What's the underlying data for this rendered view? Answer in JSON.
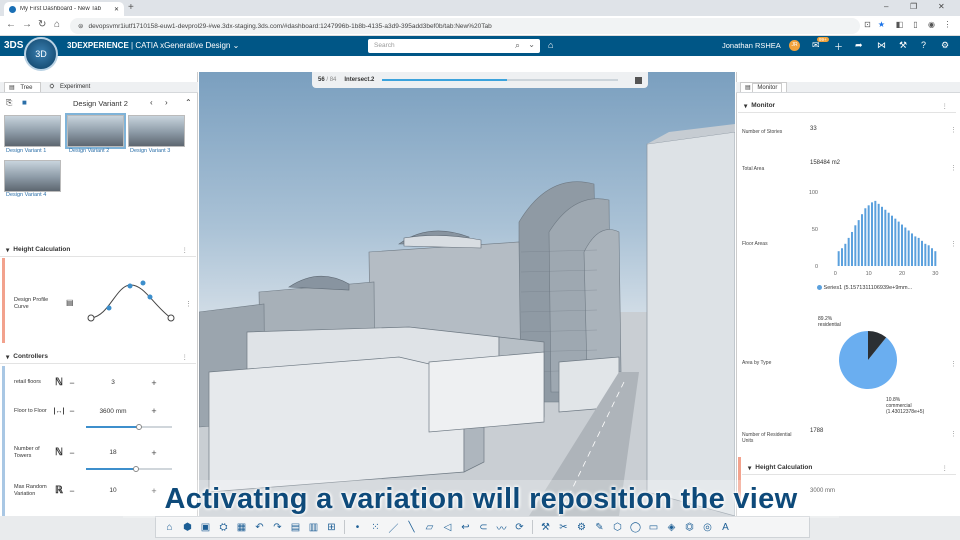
{
  "browser": {
    "tab_title": "My First Dashboard - New Tab",
    "new_tab": "+",
    "url": "devopsvmr1iutf1710158-euw1-devprol29-#we.3dx-staging.3ds.com/#dashboard:1247996b-1b8b-4135-a3d9-395add3bef0b/tab:New%20Tab",
    "window_controls": [
      "–",
      "❐",
      "✕"
    ]
  },
  "app": {
    "logo": "3DS",
    "compass_label": "3D",
    "brand": "3DEXPERIENCE",
    "separator": " | ",
    "product": "CATIA",
    "module": " xGenerative Design",
    "module_caret": "⌄",
    "search_placeholder": "Search",
    "user_name": "Jonathan RSHEA",
    "user_initials": "JR",
    "notification_count": "99+"
  },
  "left_panel": {
    "tabs": [
      "Tree",
      "Experiment"
    ],
    "variant_title": "Design Variant 2",
    "variants": [
      {
        "label": "Design Variant 1",
        "selected": false
      },
      {
        "label": "Design Variant 2",
        "selected": true
      },
      {
        "label": "Design Variant 3",
        "selected": false
      },
      {
        "label": "Design Variant 4",
        "selected": false
      }
    ],
    "height_calc": {
      "title": "Height Calculation",
      "profile_label": "Design Profile Curve"
    },
    "controllers": {
      "title": "Controllers",
      "rows": [
        {
          "label": "retail floors",
          "value": "3",
          "has_slider": false,
          "level": 0
        },
        {
          "label": "Floor to Floor",
          "value": "3600 mm",
          "has_slider": true,
          "level": 0.62
        },
        {
          "label": "Number of Towers",
          "value": "18",
          "has_slider": true,
          "level": 0.58
        },
        {
          "label": "Max Random Variation",
          "value": "10",
          "has_slider": false,
          "level": 0
        }
      ]
    }
  },
  "viewport": {
    "progress_count": "56",
    "progress_total": "/ 84",
    "progress_label": "Intersect.2",
    "progress_level": 0.53
  },
  "right_panel": {
    "tab": "Monitor",
    "section_title": "Monitor",
    "metrics": [
      {
        "label": "Number of Stories",
        "value": "33"
      },
      {
        "label": "Total Area",
        "value": "158484 m2"
      },
      {
        "label": "Floor Areas",
        "value": ""
      },
      {
        "label": "Area by Type",
        "value": ""
      },
      {
        "label": "Number of Residential Units",
        "value": "1788"
      }
    ],
    "height_calc_title": "Height Calculation",
    "height_calc_value": "3000 mm"
  },
  "chart_data": [
    {
      "type": "bar",
      "title": "",
      "ylim": [
        0,
        100
      ],
      "yticks": [
        "100",
        "50",
        "0"
      ],
      "xticks": [
        "0",
        "10",
        "20",
        "30"
      ],
      "xlim": [
        -4,
        32
      ],
      "series": [
        {
          "name": "Series1 (5.1571311106939e+9mm...",
          "color": "#5aa0dd",
          "x": [
            1,
            2,
            3,
            4,
            5,
            6,
            7,
            8,
            9,
            10,
            11,
            12,
            13,
            14,
            15,
            16,
            17,
            18,
            19,
            20,
            21,
            22,
            23,
            24,
            25,
            26,
            27,
            28,
            29,
            30
          ],
          "values": [
            20,
            24,
            30,
            38,
            46,
            55,
            62,
            70,
            78,
            82,
            86,
            88,
            84,
            80,
            76,
            72,
            68,
            64,
            60,
            56,
            52,
            48,
            44,
            40,
            38,
            34,
            30,
            28,
            24,
            20
          ]
        }
      ],
      "legend": "bottom"
    },
    {
      "type": "pie",
      "title": "",
      "slices": [
        {
          "label": "residential",
          "pct_text": "89.2%",
          "value": 89.2,
          "color": "#6aaef0"
        },
        {
          "label": "commercial (1.43012378e+5)",
          "pct_text": "10.8%",
          "value": 10.8,
          "color": "#2b2f33"
        }
      ]
    }
  ],
  "caption": "Activating a variation will reposition the view",
  "toolbar": {
    "icons": [
      "⌂",
      "⬢",
      "▣",
      "⛭",
      "▦",
      "↶",
      "↷",
      "▤",
      "▥",
      "⊞",
      "•",
      "⁙",
      "／",
      "╲",
      "▱",
      "◁",
      "↩",
      "⊂",
      "〰",
      "⟳",
      "⚒",
      "✂",
      "⚙",
      "✎",
      "⬡",
      "◯",
      "▭",
      "◈",
      "⏣",
      "◎",
      "A"
    ]
  },
  "colors": {
    "header_blue": "#005686",
    "accent": "#3d8fcc",
    "caption_text": "#0e4a7a"
  }
}
